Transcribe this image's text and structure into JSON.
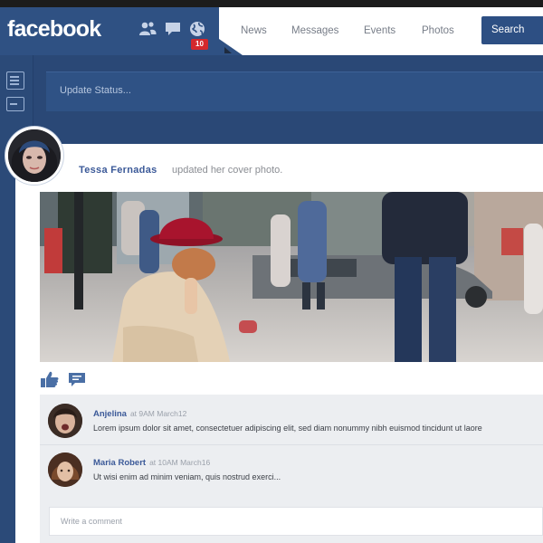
{
  "app": {
    "logo": "facebook"
  },
  "header": {
    "notification_count": "10",
    "nav": [
      "News",
      "Messages",
      "Events",
      "Photos"
    ],
    "search_label": "Search"
  },
  "status": {
    "placeholder": "Update Status..."
  },
  "post": {
    "author": "Tessa Fernadas",
    "action": "updated her cover photo."
  },
  "comments": [
    {
      "name": "Anjelina",
      "time": "at 9AM March12",
      "text": "Lorem ipsum dolor sit amet, consectetuer adipiscing elit, sed diam nonummy nibh euismod tincidunt ut laore"
    },
    {
      "name": "Maria Robert",
      "time": "at 10AM March16",
      "text": "Ut wisi enim ad minim veniam, quis nostrud exerci..."
    }
  ],
  "comment_input": {
    "placeholder": "Write a comment"
  },
  "colors": {
    "brand": "#2f5183",
    "link": "#3b5998",
    "badge": "#d4282c",
    "page_bg": "#2a4876"
  },
  "icons": [
    "friends-icon",
    "messages-icon",
    "globe-icon",
    "like-icon",
    "comment-icon",
    "status-icon",
    "photo-icon"
  ]
}
